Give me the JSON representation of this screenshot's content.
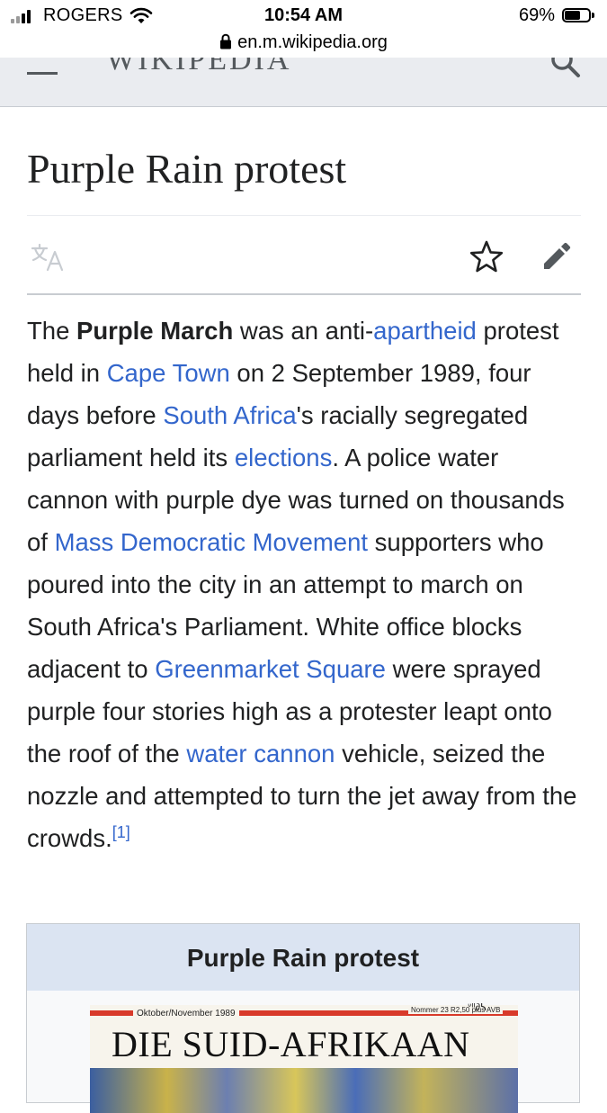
{
  "status_bar": {
    "carrier": "ROGERS",
    "time": "10:54 AM",
    "battery_percent": "69%",
    "battery_level": 0.69,
    "url": "en.m.wikipedia.org"
  },
  "header": {
    "wordmark": "WIKIPEDIA"
  },
  "page": {
    "title": "Purple Rain protest"
  },
  "lead": {
    "segments": [
      {
        "text": "The "
      },
      {
        "text": "Purple March",
        "bold": true
      },
      {
        "text": " was an anti-"
      },
      {
        "text": "apartheid",
        "link": true
      },
      {
        "text": " protest held in "
      },
      {
        "text": "Cape Town",
        "link": true
      },
      {
        "text": " on 2 September 1989, four days before "
      },
      {
        "text": "South Africa",
        "link": true
      },
      {
        "text": "'s racially segregated parliament held its "
      },
      {
        "text": "elections",
        "link": true
      },
      {
        "text": ". A police water cannon with purple dye was turned on thousands of "
      },
      {
        "text": "Mass Democratic Movement",
        "link": true
      },
      {
        "text": " supporters who poured into the city in an attempt to march on South Africa's Parliament. White office blocks adjacent to "
      },
      {
        "text": "Greenmarket Square",
        "link": true
      },
      {
        "text": " were sprayed purple four stories high as a protester leapt onto the roof of the "
      },
      {
        "text": "water cannon",
        "link": true
      },
      {
        "text": " vehicle, seized the nozzle and attempted to turn the jet away from the crowds."
      },
      {
        "text": "[1]",
        "sup": true,
        "link": true
      }
    ]
  },
  "infobox": {
    "title": "Purple Rain protest",
    "cover": {
      "date": "Oktober/November 1989",
      "issue": "Nommer 23 R2,50 plus AVB",
      "code": "ᐡᐦ∂ᓴ",
      "masthead": "DIE SUID-AFRIKAAN"
    }
  },
  "icons": {
    "menu": "hamburger-menu-icon",
    "search": "search-icon",
    "translate": "translate-icon",
    "watch": "star-icon",
    "edit": "pencil-icon",
    "lock": "lock-icon",
    "wifi": "wifi-icon",
    "signal": "cellular-signal-icon",
    "battery": "battery-icon"
  },
  "colors": {
    "link": "#3366cc",
    "text": "#202122",
    "header_bg": "#eaecf0",
    "infobox_title_bg": "#dbe4f2"
  }
}
